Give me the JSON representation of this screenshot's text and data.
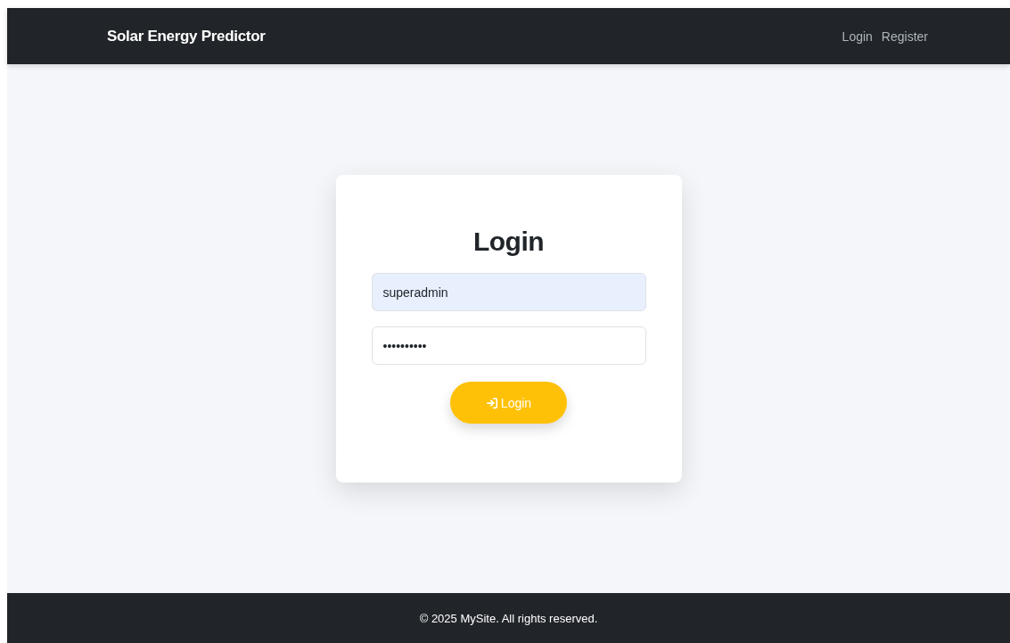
{
  "navbar": {
    "brand": "Solar Energy Predictor",
    "links": [
      {
        "label": "Login"
      },
      {
        "label": "Register"
      }
    ]
  },
  "login_form": {
    "title": "Login",
    "fields": [
      {
        "kind": "text",
        "value": "superadmin"
      },
      {
        "kind": "password",
        "value": "••••••••••"
      }
    ],
    "submit": {
      "label": "Login"
    }
  },
  "footer": {
    "text": "© 2025 MySite. All rights reserved."
  }
}
